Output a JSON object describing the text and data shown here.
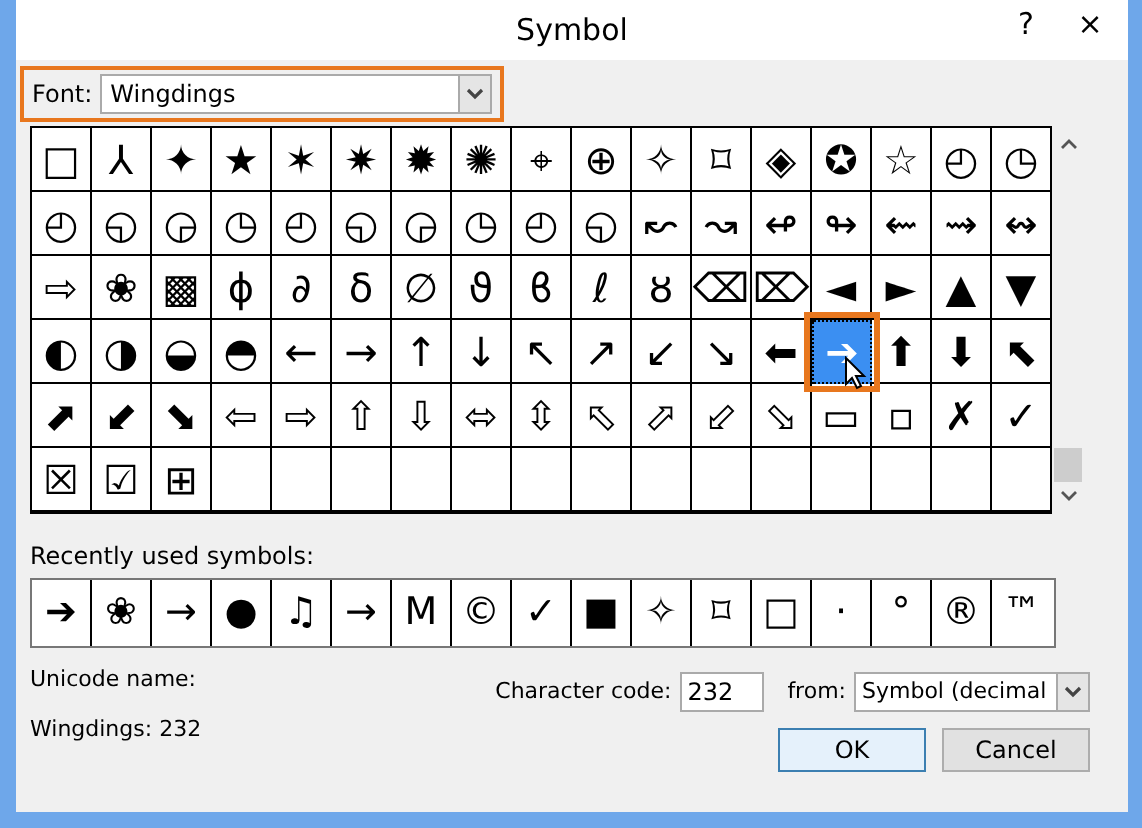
{
  "window": {
    "title": "Symbol",
    "help": "?",
    "close": "×"
  },
  "font": {
    "label": "Font:",
    "value": "Wingdings",
    "highlighted": true
  },
  "grid": {
    "rows": [
      [
        {
          "symbol": "□",
          "selected": false
        },
        {
          "symbol": "⅄",
          "selected": false
        },
        {
          "symbol": "✦",
          "selected": false
        },
        {
          "symbol": "★",
          "selected": false
        },
        {
          "symbol": "✶",
          "selected": false
        },
        {
          "symbol": "✷",
          "selected": false
        },
        {
          "symbol": "✹",
          "selected": false
        },
        {
          "symbol": "✺",
          "selected": false
        },
        {
          "symbol": "⌖",
          "selected": false
        },
        {
          "symbol": "⊕",
          "selected": false
        },
        {
          "symbol": "✧",
          "selected": false
        },
        {
          "symbol": "⌑",
          "selected": false
        },
        {
          "symbol": "◈",
          "selected": false
        },
        {
          "symbol": "✪",
          "selected": false
        },
        {
          "symbol": "☆",
          "selected": false
        },
        {
          "symbol": "◴",
          "selected": false
        },
        {
          "symbol": "◷",
          "selected": false
        }
      ],
      [
        {
          "symbol": "◴",
          "selected": false
        },
        {
          "symbol": "◵",
          "selected": false
        },
        {
          "symbol": "◶",
          "selected": false
        },
        {
          "symbol": "◷",
          "selected": false
        },
        {
          "symbol": "◴",
          "selected": false
        },
        {
          "symbol": "◵",
          "selected": false
        },
        {
          "symbol": "◶",
          "selected": false
        },
        {
          "symbol": "◷",
          "selected": false
        },
        {
          "symbol": "◴",
          "selected": false
        },
        {
          "symbol": "◵",
          "selected": false
        },
        {
          "symbol": "↜",
          "selected": false
        },
        {
          "symbol": "↝",
          "selected": false
        },
        {
          "symbol": "↫",
          "selected": false
        },
        {
          "symbol": "↬",
          "selected": false
        },
        {
          "symbol": "⇜",
          "selected": false
        },
        {
          "symbol": "⇝",
          "selected": false
        },
        {
          "symbol": "↭",
          "selected": false
        }
      ],
      [
        {
          "symbol": "⇨",
          "selected": false
        },
        {
          "symbol": "❀",
          "selected": false
        },
        {
          "symbol": "▩",
          "selected": false
        },
        {
          "symbol": "ϕ",
          "selected": false
        },
        {
          "symbol": "∂",
          "selected": false
        },
        {
          "symbol": "δ",
          "selected": false
        },
        {
          "symbol": "∅",
          "selected": false
        },
        {
          "symbol": "ϑ",
          "selected": false
        },
        {
          "symbol": "ϐ",
          "selected": false
        },
        {
          "symbol": "ℓ",
          "selected": false
        },
        {
          "symbol": "ȣ",
          "selected": false
        },
        {
          "symbol": "⌫",
          "selected": false
        },
        {
          "symbol": "⌦",
          "selected": false
        },
        {
          "symbol": "◄",
          "selected": false
        },
        {
          "symbol": "►",
          "selected": false
        },
        {
          "symbol": "▲",
          "selected": false
        },
        {
          "symbol": "▼",
          "selected": false
        }
      ],
      [
        {
          "symbol": "◐",
          "selected": false
        },
        {
          "symbol": "◑",
          "selected": false
        },
        {
          "symbol": "◒",
          "selected": false
        },
        {
          "symbol": "◓",
          "selected": false
        },
        {
          "symbol": "←",
          "selected": false
        },
        {
          "symbol": "→",
          "selected": false
        },
        {
          "symbol": "↑",
          "selected": false
        },
        {
          "symbol": "↓",
          "selected": false
        },
        {
          "symbol": "↖",
          "selected": false
        },
        {
          "symbol": "↗",
          "selected": false
        },
        {
          "symbol": "↙",
          "selected": false
        },
        {
          "symbol": "↘",
          "selected": false
        },
        {
          "symbol": "⬅",
          "selected": false
        },
        {
          "symbol": "➔",
          "selected": true
        },
        {
          "symbol": "⬆",
          "selected": false
        },
        {
          "symbol": "⬇",
          "selected": false
        },
        {
          "symbol": "⬉",
          "selected": false
        }
      ],
      [
        {
          "symbol": "⬈",
          "selected": false
        },
        {
          "symbol": "⬋",
          "selected": false
        },
        {
          "symbol": "⬊",
          "selected": false
        },
        {
          "symbol": "⇦",
          "selected": false
        },
        {
          "symbol": "⇨",
          "selected": false
        },
        {
          "symbol": "⇧",
          "selected": false
        },
        {
          "symbol": "⇩",
          "selected": false
        },
        {
          "symbol": "⬄",
          "selected": false
        },
        {
          "symbol": "⇳",
          "selected": false
        },
        {
          "symbol": "⬁",
          "selected": false
        },
        {
          "symbol": "⬀",
          "selected": false
        },
        {
          "symbol": "⬃",
          "selected": false
        },
        {
          "symbol": "⬂",
          "selected": false
        },
        {
          "symbol": "▭",
          "selected": false
        },
        {
          "symbol": "▫",
          "selected": false
        },
        {
          "symbol": "✗",
          "selected": false
        },
        {
          "symbol": "✓",
          "selected": false
        }
      ],
      [
        {
          "symbol": "☒",
          "selected": false
        },
        {
          "symbol": "☑",
          "selected": false
        },
        {
          "symbol": "⊞",
          "selected": false
        }
      ]
    ]
  },
  "recent": {
    "label": "Recently used symbols:",
    "symbols": [
      "➔",
      "❀",
      "→",
      "●",
      "♫",
      "→",
      "M",
      "©",
      "✓",
      "■",
      "✧",
      "⌑",
      "□",
      "·",
      "°",
      "®",
      "™"
    ]
  },
  "unicode_name": {
    "label": "Unicode name:",
    "value": "Wingdings: 232"
  },
  "character_code": {
    "label": "Character code:",
    "value": "232"
  },
  "from": {
    "label": "from:",
    "value": "Symbol (decimal"
  },
  "buttons": [
    {
      "label": "OK",
      "default": true
    },
    {
      "label": "Cancel",
      "default": false
    }
  ]
}
